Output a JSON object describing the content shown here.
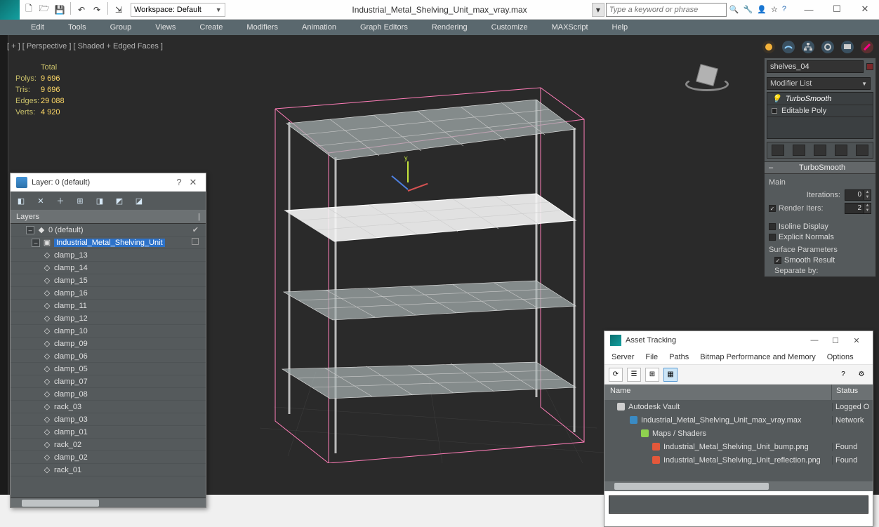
{
  "titlebar": {
    "workspace_label": "Workspace: Default",
    "document_title": "Industrial_Metal_Shelving_Unit_max_vray.max",
    "search_placeholder": "Type a keyword or phrase"
  },
  "menubar": [
    "Edit",
    "Tools",
    "Group",
    "Views",
    "Create",
    "Modifiers",
    "Animation",
    "Graph Editors",
    "Rendering",
    "Customize",
    "MAXScript",
    "Help"
  ],
  "viewport": {
    "label": "[ + ] [ Perspective ] [ Shaded + Edged Faces ]",
    "stats": {
      "header": "Total",
      "polys_label": "Polys:",
      "polys": "9 696",
      "tris_label": "Tris:",
      "tris": "9 696",
      "edges_label": "Edges:",
      "edges": "29 088",
      "verts_label": "Verts:",
      "verts": "4 920"
    }
  },
  "right_panel": {
    "object_name": "shelves_04",
    "modifier_list_label": "Modifier List",
    "stack": {
      "item1": "TurboSmooth",
      "item2": "Editable Poly"
    },
    "rollout_title": "TurboSmooth",
    "main_label": "Main",
    "iterations_label": "Iterations:",
    "iterations_value": "0",
    "render_iters_label": "Render Iters:",
    "render_iters_value": "2",
    "isoline_label": "Isoline Display",
    "explicit_label": "Explicit Normals",
    "surface_params_label": "Surface Parameters",
    "smooth_result_label": "Smooth Result",
    "separate_label": "Separate by:"
  },
  "layer_window": {
    "title": "Layer: 0 (default)",
    "header_label": "Layers",
    "root": "0 (default)",
    "group": "Industrial_Metal_Shelving_Unit",
    "items": [
      "clamp_13",
      "clamp_14",
      "clamp_15",
      "clamp_16",
      "clamp_11",
      "clamp_12",
      "clamp_10",
      "clamp_09",
      "clamp_06",
      "clamp_05",
      "clamp_07",
      "clamp_08",
      "rack_03",
      "clamp_03",
      "clamp_01",
      "rack_02",
      "clamp_02",
      "rack_01"
    ]
  },
  "asset_window": {
    "title": "Asset Tracking",
    "menus": [
      "Server",
      "File",
      "Paths",
      "Bitmap Performance and Memory",
      "Options"
    ],
    "col_name": "Name",
    "col_status": "Status",
    "rows": [
      {
        "level": 0,
        "icon": "fi-vault",
        "name": "Autodesk Vault",
        "status": "Logged O"
      },
      {
        "level": 1,
        "icon": "fi-max",
        "name": "Industrial_Metal_Shelving_Unit_max_vray.max",
        "status": "Network"
      },
      {
        "level": 2,
        "icon": "fi-folder",
        "name": "Maps / Shaders",
        "status": ""
      },
      {
        "level": 3,
        "icon": "fi-png",
        "name": "Industrial_Metal_Shelving_Unit_bump.png",
        "status": "Found"
      },
      {
        "level": 3,
        "icon": "fi-png",
        "name": "Industrial_Metal_Shelving_Unit_reflection.png",
        "status": "Found"
      }
    ]
  }
}
